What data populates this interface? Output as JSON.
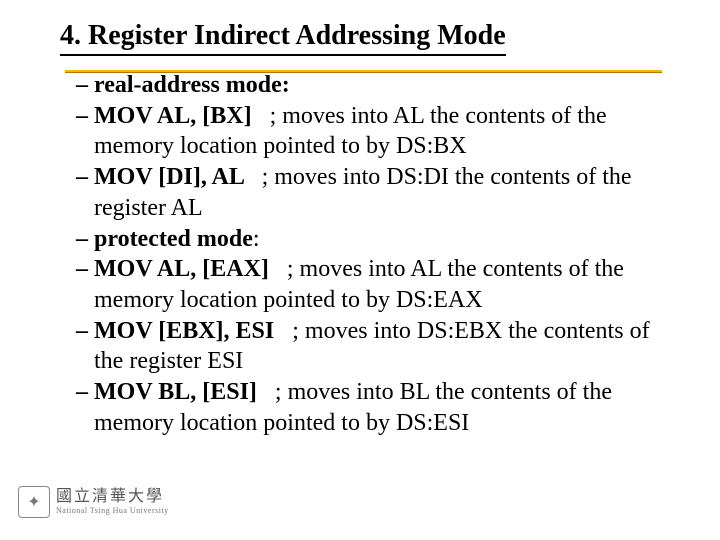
{
  "title": "4. Register Indirect Addressing Mode",
  "bullets": [
    {
      "lead": "– ",
      "bold": "real-address mode:",
      "rest": ""
    },
    {
      "lead": "– ",
      "bold": "MOV AL, [BX] ",
      "rest": "  ; moves into AL the contents of the memory location pointed to by DS:BX"
    },
    {
      "lead": "– ",
      "bold": "MOV [DI], AL ",
      "rest": "  ; moves into DS:DI the contents of the register AL"
    },
    {
      "lead": "– ",
      "bold": "protected mode",
      "rest": ":"
    },
    {
      "lead": "– ",
      "bold": "MOV AL, [EAX] ",
      "rest": "  ; moves into AL the contents of the memory location pointed to by DS:EAX"
    },
    {
      "lead": "– ",
      "bold": "MOV [EBX], ESI ",
      "rest": "  ; moves into DS:EBX the contents of the register ESI"
    },
    {
      "lead": "– ",
      "bold": "MOV BL, [ESI] ",
      "rest": "  ; moves into BL the contents of the memory location pointed to by DS:ESI"
    }
  ],
  "footer": {
    "uni_zh": "國立清華大學",
    "uni_en": "National Tsing Hua University",
    "emblem": "✦"
  }
}
